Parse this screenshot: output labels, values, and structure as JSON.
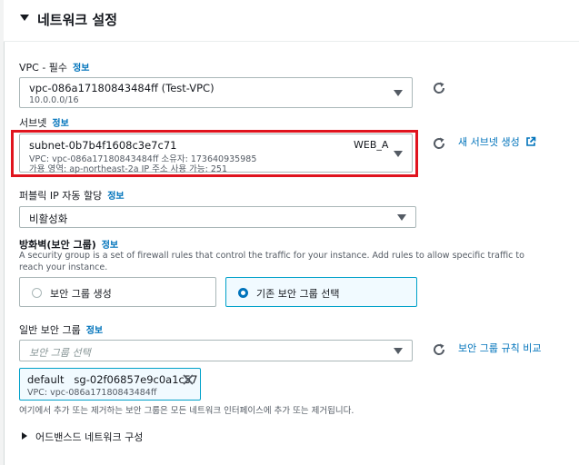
{
  "section": {
    "title": "네트워크 설정"
  },
  "vpc": {
    "label": "VPC - 필수",
    "info": "정보",
    "value": "vpc-086a17180843484ff (Test-VPC)",
    "cidr": "10.0.0.0/16"
  },
  "subnet": {
    "label": "서브넷",
    "info": "정보",
    "value": "subnet-0b7b4f1608c3e7c71",
    "name_tag": "WEB_A",
    "line2": "VPC: vpc-086a17180843484ff       소유자: 173640935985",
    "line3": "가용 영역: ap-northeast-2a      IP 주소 사용 가능: 251",
    "create_link": "새 서브넷 생성"
  },
  "public_ip": {
    "label": "퍼블릭 IP 자동 할당",
    "info": "정보",
    "value": "비활성화"
  },
  "firewall": {
    "label": "방화벽(보안 그룹)",
    "info": "정보",
    "description": "A security group is a set of firewall rules that control the traffic for your instance. Add rules to allow specific traffic to reach your instance.",
    "option_create": "보안 그룹 생성",
    "option_existing": "기존 보안 그룹 선택"
  },
  "security_group": {
    "label": "일반 보안 그룹",
    "info": "정보",
    "placeholder": "보안 그룹 선택",
    "compare_link": "보안 그룹 규칙 비교",
    "token_name": "default   sg-02f06857e9c0a1c57",
    "token_vpc": "VPC: vpc-086a17180843484ff",
    "note": "여기에서 추가 또는 제거하는 보안 그룹은 모든 네트워크 인터페이스에 추가 또는 제거됩니다."
  },
  "advanced": {
    "label": "어드밴스드 네트워크 구성"
  },
  "colors": {
    "link": "#0073bb",
    "highlight": "#e0141e",
    "selected_border": "#00a1c9"
  }
}
